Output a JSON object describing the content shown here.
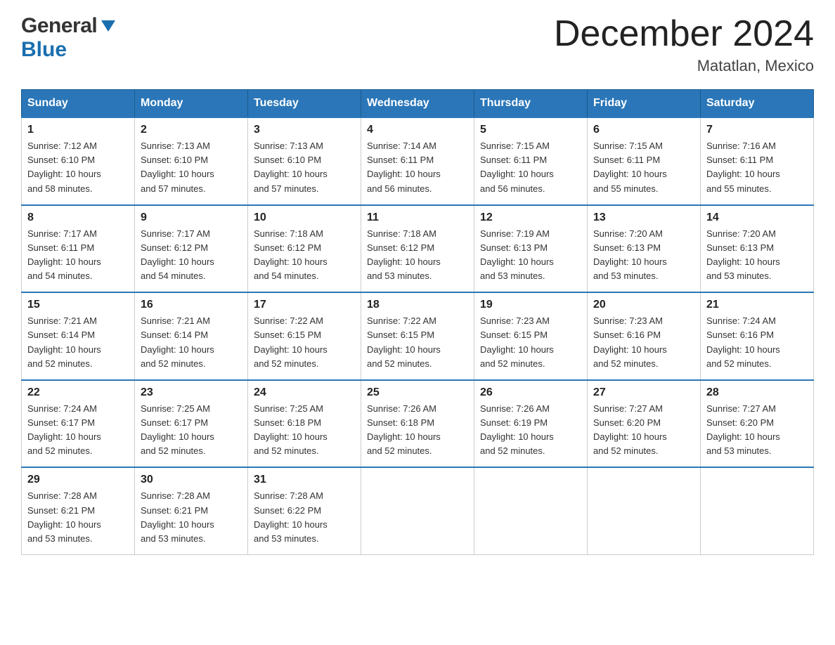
{
  "header": {
    "logo": {
      "general": "General",
      "blue": "Blue"
    },
    "title": "December 2024",
    "location": "Matatlan, Mexico"
  },
  "days_of_week": [
    "Sunday",
    "Monday",
    "Tuesday",
    "Wednesday",
    "Thursday",
    "Friday",
    "Saturday"
  ],
  "weeks": [
    [
      {
        "day": "1",
        "sunrise": "7:12 AM",
        "sunset": "6:10 PM",
        "daylight": "10 hours and 58 minutes."
      },
      {
        "day": "2",
        "sunrise": "7:13 AM",
        "sunset": "6:10 PM",
        "daylight": "10 hours and 57 minutes."
      },
      {
        "day": "3",
        "sunrise": "7:13 AM",
        "sunset": "6:10 PM",
        "daylight": "10 hours and 57 minutes."
      },
      {
        "day": "4",
        "sunrise": "7:14 AM",
        "sunset": "6:11 PM",
        "daylight": "10 hours and 56 minutes."
      },
      {
        "day": "5",
        "sunrise": "7:15 AM",
        "sunset": "6:11 PM",
        "daylight": "10 hours and 56 minutes."
      },
      {
        "day": "6",
        "sunrise": "7:15 AM",
        "sunset": "6:11 PM",
        "daylight": "10 hours and 55 minutes."
      },
      {
        "day": "7",
        "sunrise": "7:16 AM",
        "sunset": "6:11 PM",
        "daylight": "10 hours and 55 minutes."
      }
    ],
    [
      {
        "day": "8",
        "sunrise": "7:17 AM",
        "sunset": "6:11 PM",
        "daylight": "10 hours and 54 minutes."
      },
      {
        "day": "9",
        "sunrise": "7:17 AM",
        "sunset": "6:12 PM",
        "daylight": "10 hours and 54 minutes."
      },
      {
        "day": "10",
        "sunrise": "7:18 AM",
        "sunset": "6:12 PM",
        "daylight": "10 hours and 54 minutes."
      },
      {
        "day": "11",
        "sunrise": "7:18 AM",
        "sunset": "6:12 PM",
        "daylight": "10 hours and 53 minutes."
      },
      {
        "day": "12",
        "sunrise": "7:19 AM",
        "sunset": "6:13 PM",
        "daylight": "10 hours and 53 minutes."
      },
      {
        "day": "13",
        "sunrise": "7:20 AM",
        "sunset": "6:13 PM",
        "daylight": "10 hours and 53 minutes."
      },
      {
        "day": "14",
        "sunrise": "7:20 AM",
        "sunset": "6:13 PM",
        "daylight": "10 hours and 53 minutes."
      }
    ],
    [
      {
        "day": "15",
        "sunrise": "7:21 AM",
        "sunset": "6:14 PM",
        "daylight": "10 hours and 52 minutes."
      },
      {
        "day": "16",
        "sunrise": "7:21 AM",
        "sunset": "6:14 PM",
        "daylight": "10 hours and 52 minutes."
      },
      {
        "day": "17",
        "sunrise": "7:22 AM",
        "sunset": "6:15 PM",
        "daylight": "10 hours and 52 minutes."
      },
      {
        "day": "18",
        "sunrise": "7:22 AM",
        "sunset": "6:15 PM",
        "daylight": "10 hours and 52 minutes."
      },
      {
        "day": "19",
        "sunrise": "7:23 AM",
        "sunset": "6:15 PM",
        "daylight": "10 hours and 52 minutes."
      },
      {
        "day": "20",
        "sunrise": "7:23 AM",
        "sunset": "6:16 PM",
        "daylight": "10 hours and 52 minutes."
      },
      {
        "day": "21",
        "sunrise": "7:24 AM",
        "sunset": "6:16 PM",
        "daylight": "10 hours and 52 minutes."
      }
    ],
    [
      {
        "day": "22",
        "sunrise": "7:24 AM",
        "sunset": "6:17 PM",
        "daylight": "10 hours and 52 minutes."
      },
      {
        "day": "23",
        "sunrise": "7:25 AM",
        "sunset": "6:17 PM",
        "daylight": "10 hours and 52 minutes."
      },
      {
        "day": "24",
        "sunrise": "7:25 AM",
        "sunset": "6:18 PM",
        "daylight": "10 hours and 52 minutes."
      },
      {
        "day": "25",
        "sunrise": "7:26 AM",
        "sunset": "6:18 PM",
        "daylight": "10 hours and 52 minutes."
      },
      {
        "day": "26",
        "sunrise": "7:26 AM",
        "sunset": "6:19 PM",
        "daylight": "10 hours and 52 minutes."
      },
      {
        "day": "27",
        "sunrise": "7:27 AM",
        "sunset": "6:20 PM",
        "daylight": "10 hours and 52 minutes."
      },
      {
        "day": "28",
        "sunrise": "7:27 AM",
        "sunset": "6:20 PM",
        "daylight": "10 hours and 53 minutes."
      }
    ],
    [
      {
        "day": "29",
        "sunrise": "7:28 AM",
        "sunset": "6:21 PM",
        "daylight": "10 hours and 53 minutes."
      },
      {
        "day": "30",
        "sunrise": "7:28 AM",
        "sunset": "6:21 PM",
        "daylight": "10 hours and 53 minutes."
      },
      {
        "day": "31",
        "sunrise": "7:28 AM",
        "sunset": "6:22 PM",
        "daylight": "10 hours and 53 minutes."
      },
      null,
      null,
      null,
      null
    ]
  ],
  "labels": {
    "sunrise": "Sunrise:",
    "sunset": "Sunset:",
    "daylight": "Daylight:"
  }
}
